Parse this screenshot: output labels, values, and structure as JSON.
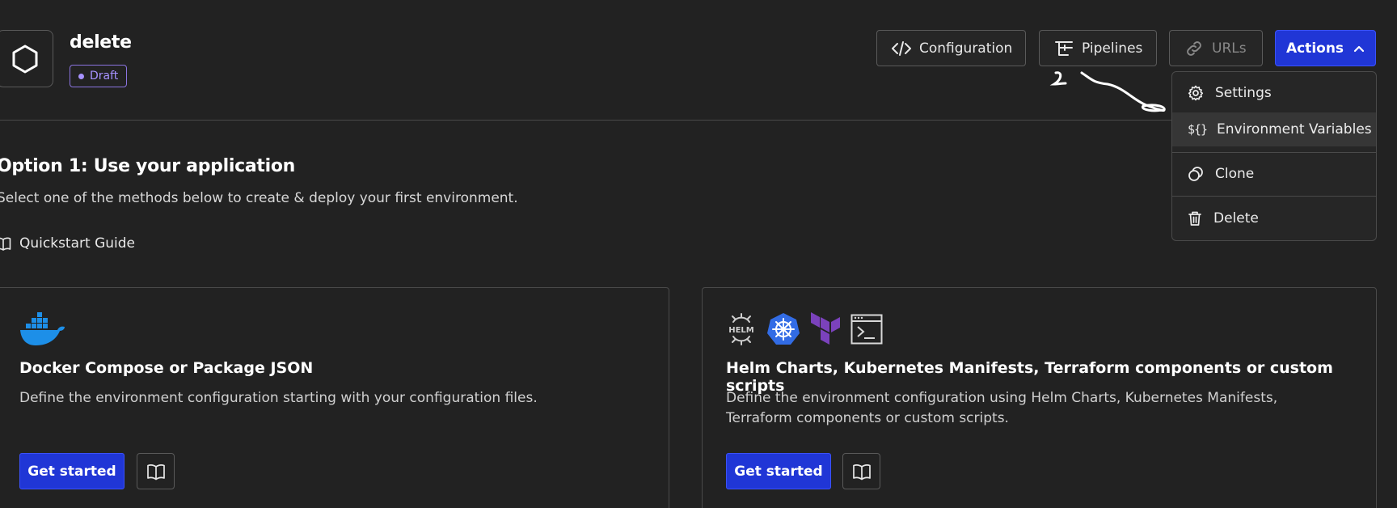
{
  "app": {
    "title": "delete",
    "status": "Draft"
  },
  "header": {
    "configuration_label": "Configuration",
    "pipelines_label": "Pipelines",
    "urls_label": "URLs",
    "actions_label": "Actions"
  },
  "actions_menu": {
    "items": [
      {
        "label": "Settings",
        "icon": "gear-icon"
      },
      {
        "label": "Environment Variables",
        "icon": "variables-icon",
        "hovered": true
      },
      {
        "label": "Clone",
        "icon": "clone-icon"
      },
      {
        "label": "Delete",
        "icon": "trash-icon"
      }
    ]
  },
  "option": {
    "title": "Option 1: Use your application",
    "subtitle": "Select one of the methods below to create & deploy your first environment.",
    "quickstart_label": "Quickstart Guide"
  },
  "cards": [
    {
      "title": "Docker Compose or Package JSON",
      "description": "Define the environment configuration starting with your configuration files.",
      "button_label": "Get started",
      "logos": [
        "docker-logo"
      ]
    },
    {
      "title": "Helm Charts, Kubernetes Manifests, Terraform components or custom scripts",
      "description": "Define the environment configuration using Helm Charts, Kubernetes Manifests, Terraform components or custom scripts.",
      "button_label": "Get started",
      "logos": [
        "helm-logo",
        "kubernetes-logo",
        "terraform-logo",
        "terminal-logo"
      ],
      "helm_text": "HELM"
    }
  ],
  "colors": {
    "background": "#222222",
    "primary": "#2036d6",
    "draft": "#a792ff",
    "border": "#4a4a4a"
  }
}
